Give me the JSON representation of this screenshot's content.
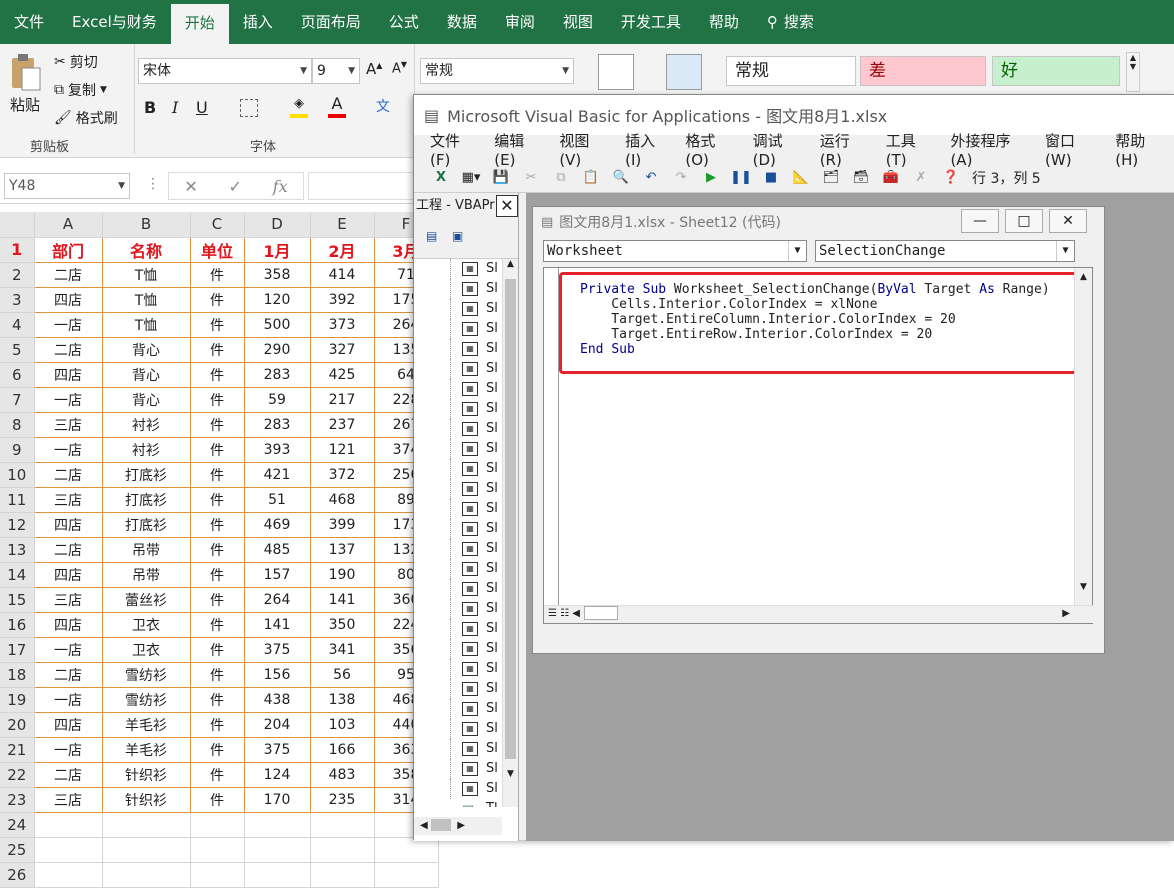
{
  "menubar": {
    "tabs": [
      "文件",
      "Excel与财务",
      "开始",
      "插入",
      "页面布局",
      "公式",
      "数据",
      "审阅",
      "视图",
      "开发工具",
      "帮助"
    ],
    "active": "开始",
    "search": "搜索"
  },
  "ribbon": {
    "clipboard": {
      "paste": "粘贴",
      "cut": "剪切",
      "copy": "复制",
      "format_painter": "格式刷",
      "group": "剪贴板"
    },
    "font": {
      "name": "宋体",
      "size": "9",
      "group": "字体",
      "bold": "B",
      "italic": "I",
      "underline": "U"
    },
    "number": {
      "format": "常规"
    },
    "styles": {
      "normal": "常规",
      "bad": "差",
      "good": "好"
    }
  },
  "formula_bar": {
    "name_box": "Y48",
    "fx": "fx"
  },
  "sheet": {
    "columns": [
      "A",
      "B",
      "C",
      "D",
      "E",
      "F"
    ],
    "header": [
      "部门",
      "名称",
      "单位",
      "1月",
      "2月",
      "3月"
    ],
    "rows": [
      [
        "二店",
        "T恤",
        "件",
        "358",
        "414",
        "71"
      ],
      [
        "四店",
        "T恤",
        "件",
        "120",
        "392",
        "175"
      ],
      [
        "一店",
        "T恤",
        "件",
        "500",
        "373",
        "264"
      ],
      [
        "二店",
        "背心",
        "件",
        "290",
        "327",
        "135"
      ],
      [
        "四店",
        "背心",
        "件",
        "283",
        "425",
        "64"
      ],
      [
        "一店",
        "背心",
        "件",
        "59",
        "217",
        "228"
      ],
      [
        "三店",
        "衬衫",
        "件",
        "283",
        "237",
        "267"
      ],
      [
        "一店",
        "衬衫",
        "件",
        "393",
        "121",
        "374"
      ],
      [
        "二店",
        "打底衫",
        "件",
        "421",
        "372",
        "256"
      ],
      [
        "三店",
        "打底衫",
        "件",
        "51",
        "468",
        "89"
      ],
      [
        "四店",
        "打底衫",
        "件",
        "469",
        "399",
        "173"
      ],
      [
        "二店",
        "吊带",
        "件",
        "485",
        "137",
        "132"
      ],
      [
        "四店",
        "吊带",
        "件",
        "157",
        "190",
        "80"
      ],
      [
        "三店",
        "蕾丝衫",
        "件",
        "264",
        "141",
        "360"
      ],
      [
        "四店",
        "卫衣",
        "件",
        "141",
        "350",
        "224"
      ],
      [
        "一店",
        "卫衣",
        "件",
        "375",
        "341",
        "356"
      ],
      [
        "二店",
        "雪纺衫",
        "件",
        "156",
        "56",
        "95"
      ],
      [
        "一店",
        "雪纺衫",
        "件",
        "438",
        "138",
        "468"
      ],
      [
        "四店",
        "羊毛衫",
        "件",
        "204",
        "103",
        "440"
      ],
      [
        "一店",
        "羊毛衫",
        "件",
        "375",
        "166",
        "363"
      ],
      [
        "二店",
        "针织衫",
        "件",
        "124",
        "483",
        "358"
      ],
      [
        "三店",
        "针织衫",
        "件",
        "170",
        "235",
        "314"
      ]
    ],
    "row_numbers": [
      "1",
      "2",
      "3",
      "4",
      "5",
      "6",
      "7",
      "8",
      "9",
      "10",
      "11",
      "12",
      "13",
      "14",
      "15",
      "16",
      "17",
      "18",
      "19",
      "20",
      "21",
      "22",
      "23",
      "24",
      "25",
      "26"
    ]
  },
  "vba": {
    "title": "Microsoft Visual Basic for Applications - 图文用8月1.xlsx",
    "menu": [
      "文件(F)",
      "编辑(E)",
      "视图(V)",
      "插入(I)",
      "格式(O)",
      "调试(D)",
      "运行(R)",
      "工具(T)",
      "外接程序(A)",
      "窗口(W)",
      "帮助(H)"
    ],
    "cursor_pos": "行 3，列 5",
    "project_title": "工程 - VBAPr",
    "tree_item": "Sl",
    "tree_last": "Tl",
    "code_window": {
      "title": "图文用8月1.xlsx - Sheet12 (代码)",
      "object": "Worksheet",
      "procedure": "SelectionChange",
      "lines": [
        "Private Sub Worksheet_SelectionChange(ByVal Target As Range)",
        "    Cells.Interior.ColorIndex = xlNone",
        "    Target.EntireColumn.Interior.ColorIndex = 20",
        "    Target.EntireRow.Interior.ColorIndex = 20",
        "End Sub"
      ]
    }
  }
}
